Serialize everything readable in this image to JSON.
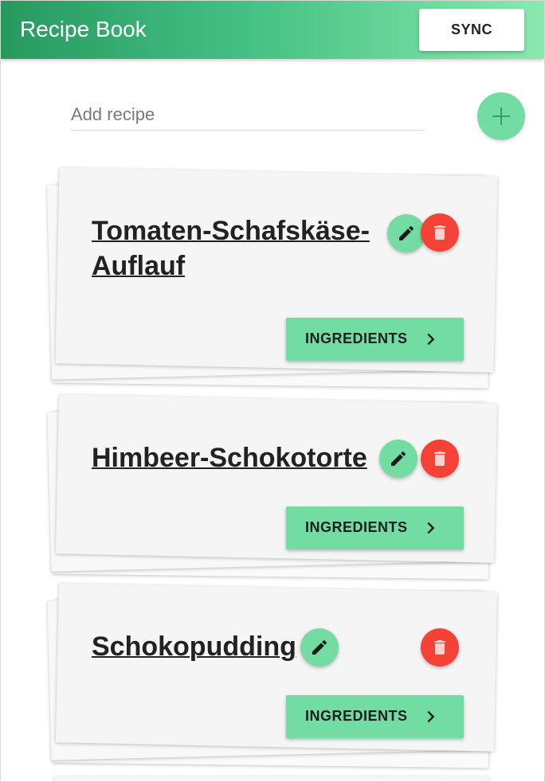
{
  "app": {
    "title": "Recipe Book",
    "sync_label": "SYNC"
  },
  "add": {
    "placeholder": "Add recipe",
    "value": ""
  },
  "recipes": [
    {
      "title_line1": "Tomaten-Schafskäse-",
      "title_line2": "Auflauf",
      "ingredients_label": "INGREDIENTS"
    },
    {
      "title": "Himbeer-Schokotorte",
      "ingredients_label": "INGREDIENTS"
    },
    {
      "title": "Schokopudding",
      "ingredients_label": "INGREDIENTS"
    }
  ],
  "icons": {
    "add": "plus-icon",
    "edit": "pencil-icon",
    "delete": "trash-icon",
    "ingredients": "chevron-right-icon"
  },
  "colors": {
    "accent": "#72dca3",
    "appbar_start": "#27995f",
    "appbar_end": "#89e9ae",
    "delete": "#f44336"
  }
}
